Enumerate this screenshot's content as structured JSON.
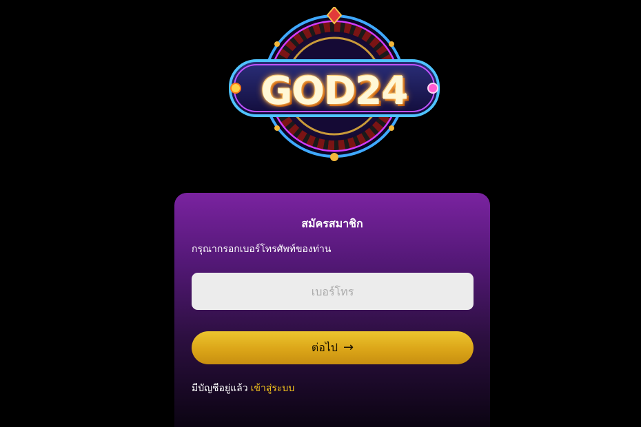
{
  "logo": {
    "text": "GOD24"
  },
  "form": {
    "title": "สมัครสมาชิก",
    "label": "กรุณากรอกเบอร์โทรศัพท์ของท่าน",
    "phone_placeholder": "เบอร์โทร",
    "phone_value": "",
    "next_label": "ต่อไป",
    "next_icon": "arrow-right-icon",
    "existing_account_text": "มีบัญชีอยู่แล้ว",
    "login_link": "เข้าสู่ระบบ"
  },
  "colors": {
    "background": "#000000",
    "card_top": "#7a23a0",
    "card_bottom": "#0b0412",
    "button_gold": "#dba518",
    "link_gold": "#f3c21c",
    "input_bg": "#ececec"
  }
}
